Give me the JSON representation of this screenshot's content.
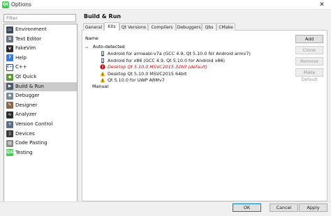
{
  "window": {
    "title": "Options",
    "app_icon": "qt-icon",
    "close_glyph": "✕"
  },
  "filter": {
    "placeholder": "Filter",
    "value": ""
  },
  "categories": [
    {
      "label": "Environment",
      "icon": "monitor-icon",
      "color": "#3c4a5a",
      "glyph": "▭"
    },
    {
      "label": "Text Editor",
      "icon": "text-editor-icon",
      "color": "#6a7480",
      "glyph": "≡"
    },
    {
      "label": "FakeVim",
      "icon": "fakevim-icon",
      "color": "#2b2b2b",
      "glyph": "v"
    },
    {
      "label": "Help",
      "icon": "help-icon",
      "color": "#3a7bd5",
      "glyph": "?"
    },
    {
      "label": "C++",
      "icon": "cpp-icon",
      "color": "#ffffff",
      "glyph": "C++"
    },
    {
      "label": "Qt Quick",
      "icon": "qt-quick-icon",
      "color": "#5a9a3a",
      "glyph": "◆"
    },
    {
      "label": "Build & Run",
      "icon": "build-run-icon",
      "color": "#4a5a6a",
      "glyph": "▶"
    },
    {
      "label": "Debugger",
      "icon": "debugger-icon",
      "color": "#7a8a98",
      "glyph": "✱"
    },
    {
      "label": "Designer",
      "icon": "designer-icon",
      "color": "#8a6a4a",
      "glyph": "✎"
    },
    {
      "label": "Analyzer",
      "icon": "analyzer-icon",
      "color": "#2b2b2b",
      "glyph": "∿"
    },
    {
      "label": "Version Control",
      "icon": "version-control-icon",
      "color": "#5a6e86",
      "glyph": "⑂"
    },
    {
      "label": "Devices",
      "icon": "devices-icon",
      "color": "#3a3a3a",
      "glyph": "▯"
    },
    {
      "label": "Code Pasting",
      "icon": "code-pasting-icon",
      "color": "#8a8a8a",
      "glyph": "▤"
    },
    {
      "label": "Testing",
      "icon": "testing-icon",
      "color": "#41cd52",
      "glyph": "QA"
    }
  ],
  "selected_category": "Build & Run",
  "page": {
    "title": "Build & Run"
  },
  "tabs": [
    "General",
    "Kits",
    "Qt Versions",
    "Compilers",
    "Debuggers",
    "Qbs",
    "CMake"
  ],
  "active_tab": "Kits",
  "kits": {
    "header": "Name",
    "group_auto": "Auto-detected",
    "items": [
      {
        "label": "Android for armeabi-v7a (GCC 4.9, Qt 5.10.0 for Android armv7)",
        "status": "ok",
        "icon": "android-device-icon",
        "color": "#111111"
      },
      {
        "label": "Android for x86 (GCC 4.9, Qt 5.10.0 for Android x86)",
        "status": "ok",
        "icon": "android-device-icon",
        "color": "#111111"
      },
      {
        "label": "Desktop Qt 5.10.0 MSVC2015 32bit (default)",
        "status": "error",
        "icon": "error-icon",
        "color": "#cc0000"
      },
      {
        "label": "Desktop Qt 5.10.0 MSVC2015 64bit",
        "status": "warning",
        "icon": "warning-icon",
        "color": "#111111"
      },
      {
        "label": "Qt 5.10.0 for UWP ARMv7",
        "status": "warning",
        "icon": "warning-icon",
        "color": "#111111"
      }
    ],
    "group_manual": "Manual"
  },
  "side_buttons": [
    {
      "label": "Add",
      "enabled": true
    },
    {
      "label": "Clone",
      "enabled": false
    },
    {
      "label": "Remove",
      "enabled": false
    },
    {
      "label": "Make Default",
      "enabled": false
    }
  ],
  "footer_buttons": [
    {
      "label": "OK",
      "primary": true
    },
    {
      "label": "Cancel",
      "primary": false
    },
    {
      "label": "Apply",
      "primary": false
    }
  ],
  "colors": {
    "accent": "#0078d7",
    "selected_bg": "#cccccc",
    "error": "#cc0000",
    "warning": "#f0b400"
  }
}
